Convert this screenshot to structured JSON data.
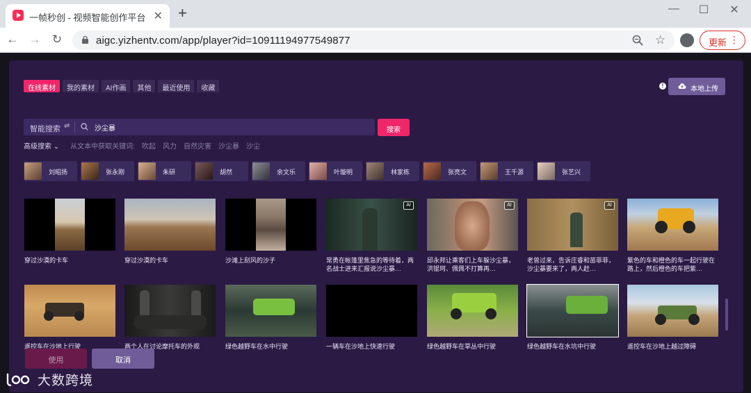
{
  "browser": {
    "tab_title": "一帧秒创 - 视频智能创作平台 - A",
    "url": "aigc.yizhentv.com/app/player?id=10911194977549877",
    "update_label": "更新"
  },
  "filter_tabs": [
    "在线素材",
    "我的素材",
    "AI作画",
    "其他",
    "最近使用",
    "收藏"
  ],
  "upload_label": "本地上传",
  "search": {
    "mode_label": "智能搜索",
    "query": "沙尘暴",
    "button_label": "搜索"
  },
  "keywords": {
    "advanced_label": "高级搜索",
    "hint": "从文本中获取关键词:",
    "items": [
      "吹起",
      "风力",
      "自然灾害",
      "沙尘暴",
      "沙尘"
    ]
  },
  "people": [
    "刘昭扬",
    "张永刚",
    "朱研",
    "胡然",
    "余文乐",
    "叶璇明",
    "林家栋",
    "张亮文",
    "王千源",
    "张艺兴"
  ],
  "videos": [
    {
      "caption": "穿过沙漠的卡车",
      "ai": false
    },
    {
      "caption": "穿过沙漠的卡车",
      "ai": false
    },
    {
      "caption": "沙滩上刮风的沙子",
      "ai": false
    },
    {
      "caption": "常勇在帐篷里焦急的等待着，两名战士进来汇报说沙尘暴…",
      "ai": true
    },
    {
      "caption": "邱永邦让乘客们上车躲沙尘暴，洪锟珂、佩佩不打算再…",
      "ai": true
    },
    {
      "caption": "老曾过来，告诉庄睿和苗菲菲，沙尘暴要来了，两人赶…",
      "ai": true
    },
    {
      "caption": "紫色的车和橙色的车一起行驶在路上，然后橙色的车把紫…",
      "ai": false
    },
    {
      "caption": "遥控车在沙地上行驶",
      "ai": false
    },
    {
      "caption": "两个人在讨论摩托车的外观",
      "ai": false
    },
    {
      "caption": "绿色越野车在水中行驶",
      "ai": false
    },
    {
      "caption": "一辆车在沙地上快速行驶",
      "ai": false
    },
    {
      "caption": "绿色越野车在草丛中行驶",
      "ai": false
    },
    {
      "caption": "绿色越野车在水坑中行驶",
      "ai": false
    },
    {
      "caption": "遥控车在沙地上越过障碍",
      "ai": false
    }
  ],
  "actions": {
    "use": "使用",
    "cancel": "取消"
  },
  "watermark": "大数跨境"
}
